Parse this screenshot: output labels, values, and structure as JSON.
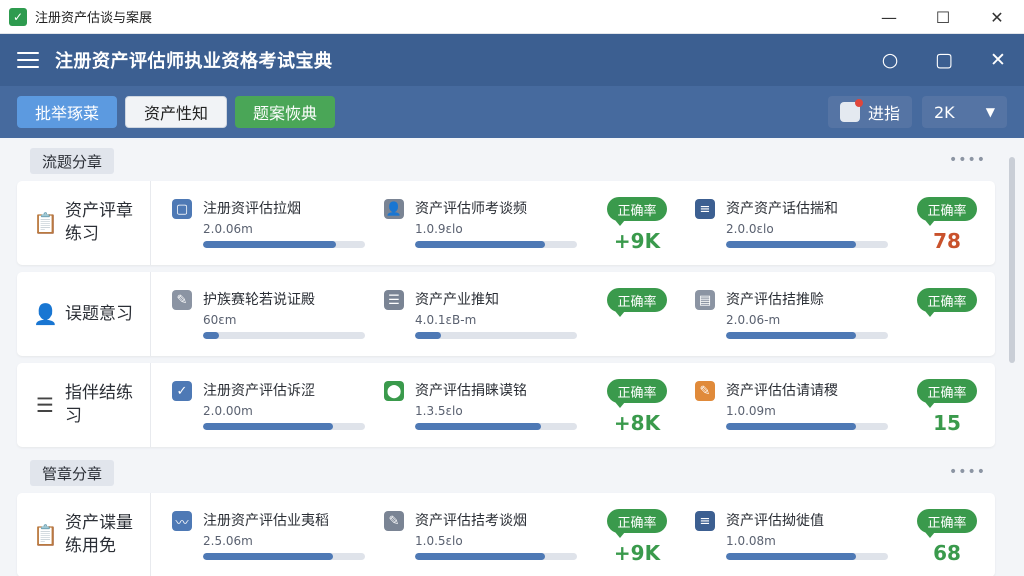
{
  "window": {
    "title": "注册资产估谈与案展",
    "icon": "app-logo-icon"
  },
  "header": {
    "title": "注册资产评估师执业资格考试宝典"
  },
  "toolbar": {
    "tabs": [
      "批举琢菜",
      "资产性知",
      "题案恢典"
    ],
    "progress_label": "进指",
    "zoom": "2K"
  },
  "sections": [
    {
      "title": "流题分章",
      "rows": [
        {
          "label": "资产评章练习",
          "items": [
            {
              "title": "注册资评估拉烟",
              "sub": "2.0.06m",
              "progress": 0.82,
              "icon_color": "#4e79b5"
            },
            {
              "title": "资产评估师考谈频",
              "sub": "1.0.9εlo",
              "progress": 0.8,
              "icon_color": "#7a8494"
            },
            {
              "title": "资产资产话估揣和",
              "sub": "2.0.0εlo",
              "progress": 0.8,
              "icon_color": "#3c5f91"
            }
          ],
          "badges": [
            {
              "label": "正确率",
              "value": "+9K",
              "color": "green"
            },
            {
              "label": "正确率",
              "value": "78",
              "color": "red"
            }
          ]
        },
        {
          "label": "误题意习",
          "items": [
            {
              "title": "护族赛轮若说证殿",
              "sub": "60εm",
              "progress": 0.1,
              "icon_color": "#8b94a3"
            },
            {
              "title": "资产产业推知",
              "sub": "4.0.1εB-m",
              "progress": 0.16,
              "icon_color": "#7a8494"
            },
            {
              "title": "资产评估拮推赊",
              "sub": "2.0.06-m",
              "progress": 0.8,
              "icon_color": "#8b94a3"
            }
          ],
          "badges": [
            {
              "label": "正确率",
              "value": "",
              "color": "green"
            },
            {
              "label": "正确率",
              "value": "",
              "color": "green"
            }
          ]
        },
        {
          "label": "指伴结练习",
          "items": [
            {
              "title": "注册资产评估诉涩",
              "sub": "2.0.00m",
              "progress": 0.8,
              "icon_color": "#4e79b5"
            },
            {
              "title": "资产评估捐睐谟铭",
              "sub": "1.3.5εlo",
              "progress": 0.78,
              "icon_color": "#3a9a4c"
            },
            {
              "title": "资产评估估请请稷",
              "sub": "1.0.09m",
              "progress": 0.8,
              "icon_color": "#e08a3a"
            }
          ],
          "badges": [
            {
              "label": "正确率",
              "value": "+8K",
              "color": "green"
            },
            {
              "label": "正确率",
              "value": "15",
              "color": "green"
            }
          ]
        }
      ]
    },
    {
      "title": "管章分章",
      "rows": [
        {
          "label": "资产谍量练用免",
          "items": [
            {
              "title": "注册资产评估业夷稻",
              "sub": "2.5.06m",
              "progress": 0.8,
              "icon_color": "#4e79b5"
            },
            {
              "title": "资产评估拮考谈烟",
              "sub": "1.0.5εlo",
              "progress": 0.8,
              "icon_color": "#7a8494"
            },
            {
              "title": "资产评估拗徙值",
              "sub": "1.0.08m",
              "progress": 0.8,
              "icon_color": "#3c5f91"
            }
          ],
          "badges": [
            {
              "label": "正确率",
              "value": "+9K",
              "color": "green"
            },
            {
              "label": "正确率",
              "value": "68",
              "color": "green"
            }
          ]
        }
      ]
    }
  ]
}
